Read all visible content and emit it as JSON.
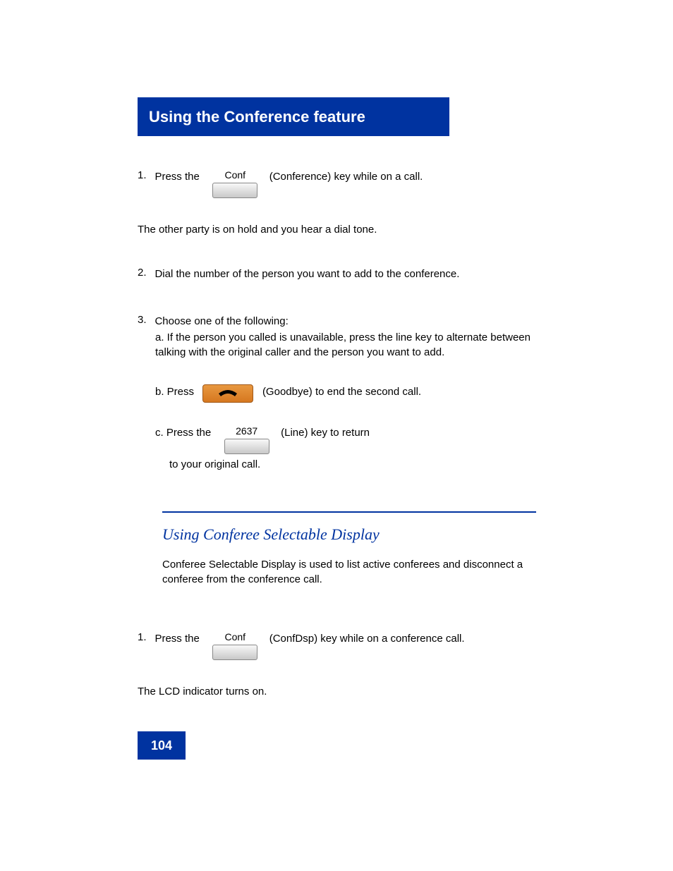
{
  "header": {
    "title": "Using the Conference feature"
  },
  "step1": {
    "num": "1.",
    "text_before": "Press the",
    "softkey_label": "Conf",
    "text_after_line1": "(Conference) key while on a call.",
    "text_follow": "The other party is on hold and you hear a dial tone."
  },
  "step2": {
    "num": "2.",
    "text": "Dial the number of the person you want to add to the conference."
  },
  "step3": {
    "num": "3.",
    "text": "Choose one of the following:"
  },
  "option_a": "a. If the person you called is unavailable, press the line key to alternate between talking with the original caller and the person you want to add.",
  "option_b": {
    "prefix": "b. Press",
    "suffix": "(Goodbye) to end the second call."
  },
  "option_c": {
    "prefix": "c. Press the",
    "softkey_label": "2637",
    "mid": "(Line) key to return",
    "after": "to your original call."
  },
  "section2": {
    "title": "Using Conferee Selectable Display",
    "body": "Conferee Selectable Display is used to list active conferees and disconnect a conferee from the conference call."
  },
  "step1b": {
    "num": "1.",
    "text_before": "Press the",
    "softkey_label": "Conf",
    "text_after": "(ConfDsp) key while on a conference call.",
    "text_follow": "The LCD indicator turns on."
  },
  "page_num": "104"
}
